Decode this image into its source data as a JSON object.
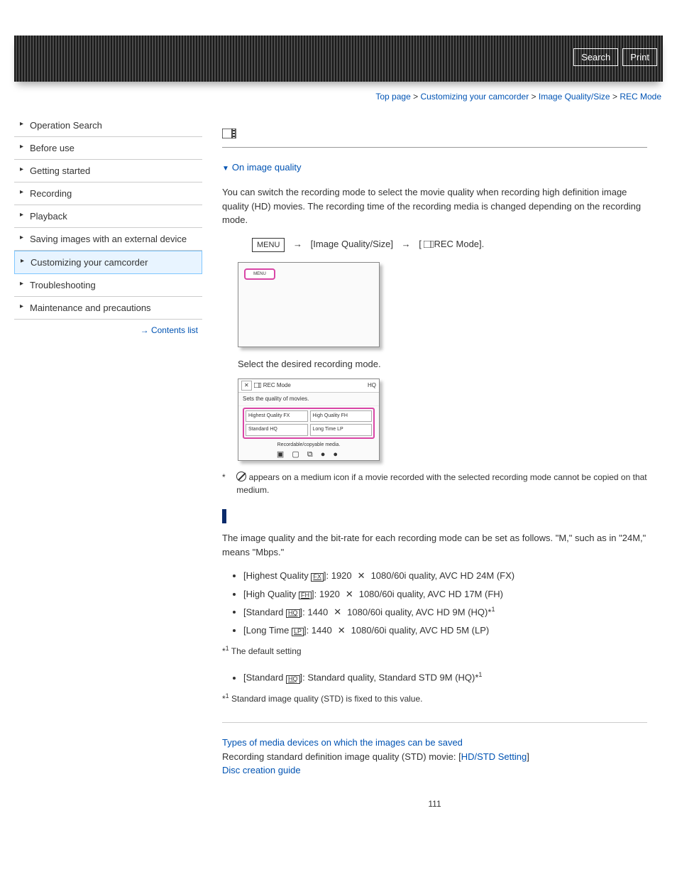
{
  "header": {
    "search": "Search",
    "print": "Print"
  },
  "breadcrumb": {
    "top": "Top page",
    "sep": ">",
    "l1": "Customizing your camcorder",
    "l2": "Image Quality/Size",
    "l3": "REC Mode"
  },
  "sidebar": {
    "items": [
      "Operation Search",
      "Before use",
      "Getting started",
      "Recording",
      "Playback",
      "Saving images with an external device",
      "Customizing your camcorder",
      "Troubleshooting",
      "Maintenance and precautions"
    ],
    "contents_arrow": "→",
    "contents": "Contents list"
  },
  "main": {
    "on_image_quality": "On image quality",
    "intro": "You can switch the recording mode to select the movie quality when recording high definition image quality (HD) movies. The recording time of the recording media is changed depending on the recording mode.",
    "menu_label": "MENU",
    "step_mid": "[Image Quality/Size]",
    "step_end": "REC Mode].",
    "select_line": "Select the desired recording mode.",
    "ss2_title": "REC Mode",
    "ss2_sub": "Sets the quality of movies.",
    "ss2_opts": [
      "Highest Quality FX",
      "High Quality FH",
      "Standard HQ",
      "Long Time LP"
    ],
    "ss2_footer": "Recordable/copyable media.",
    "asterisk": "*",
    "no_copy_note": "appears on a medium icon if a movie recorded with the selected recording mode cannot be copied on that medium.",
    "section2_para": "The image quality and the bit-rate for each recording mode can be set as follows. \"M,\" such as in \"24M,\" means \"Mbps.\"",
    "modes": [
      {
        "label": "[Highest Quality ",
        "badge": "FX",
        "rest1": "]: 1920",
        "rest2": "1080/60i quality, AVC HD 24M (FX)"
      },
      {
        "label": "[High Quality ",
        "badge": "FH",
        "rest1": "]: 1920",
        "rest2": "1080/60i quality, AVC HD 17M (FH)"
      },
      {
        "label": "[Standard ",
        "badge": "HQ",
        "rest1": "]: 1440",
        "rest2": "1080/60i quality, AVC HD 9M (HQ)*",
        "sup": "1"
      },
      {
        "label": "[Long Time ",
        "badge": "LP",
        "rest1": "]: 1440",
        "rest2": "1080/60i quality, AVC HD 5M (LP)"
      }
    ],
    "footnote1": "*",
    "footnote1_sup": "1",
    "footnote1_text": " The default setting",
    "std_mode": {
      "label": "[Standard ",
      "badge": "HQ",
      "rest": "]: Standard quality, Standard STD 9M (HQ)*",
      "sup": "1"
    },
    "footnote2_text": " Standard image quality (STD) is fixed to this value.",
    "related": {
      "link1": "Types of media devices on which the images can be saved",
      "line2a": "Recording standard definition image quality (STD) movie: [",
      "line2link": "HD/STD Setting",
      "line2b": "]",
      "link3": "Disc creation guide"
    },
    "page_num": "111"
  }
}
